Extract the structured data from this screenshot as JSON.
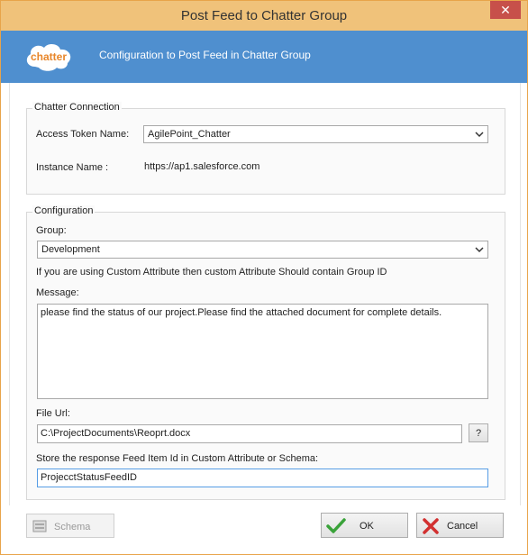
{
  "window": {
    "title": "Post Feed to Chatter Group",
    "close_glyph": "✕"
  },
  "banner": {
    "logo_text": "chatter",
    "text": "Configuration to Post Feed in Chatter Group"
  },
  "connection": {
    "legend": "Chatter Connection",
    "access_token_label": "Access Token Name:",
    "access_token_value": "AgilePoint_Chatter",
    "instance_label": "Instance Name :",
    "instance_value": "https://ap1.salesforce.com"
  },
  "configuration": {
    "legend": "Configuration",
    "group_label": "Group:",
    "group_value": "Development",
    "group_hint": "If you are using Custom Attribute  then custom Attribute Should contain Group ID",
    "message_label": "Message:",
    "message_value": "please find the status of our project.Please find the attached document for complete details.",
    "file_url_label": "File Url:",
    "file_url_value": "C:\\ProjectDocuments\\Reoprt.docx",
    "help_button": "?",
    "store_label": "Store the response Feed Item Id in Custom Attribute or Schema:",
    "store_value": "ProjecctStatusFeedID"
  },
  "footer": {
    "schema_label": "Schema",
    "ok_label": "OK",
    "cancel_label": "Cancel"
  },
  "colors": {
    "titlebar": "#f0c27a",
    "banner": "#4f8fcf",
    "close": "#c7504a"
  }
}
